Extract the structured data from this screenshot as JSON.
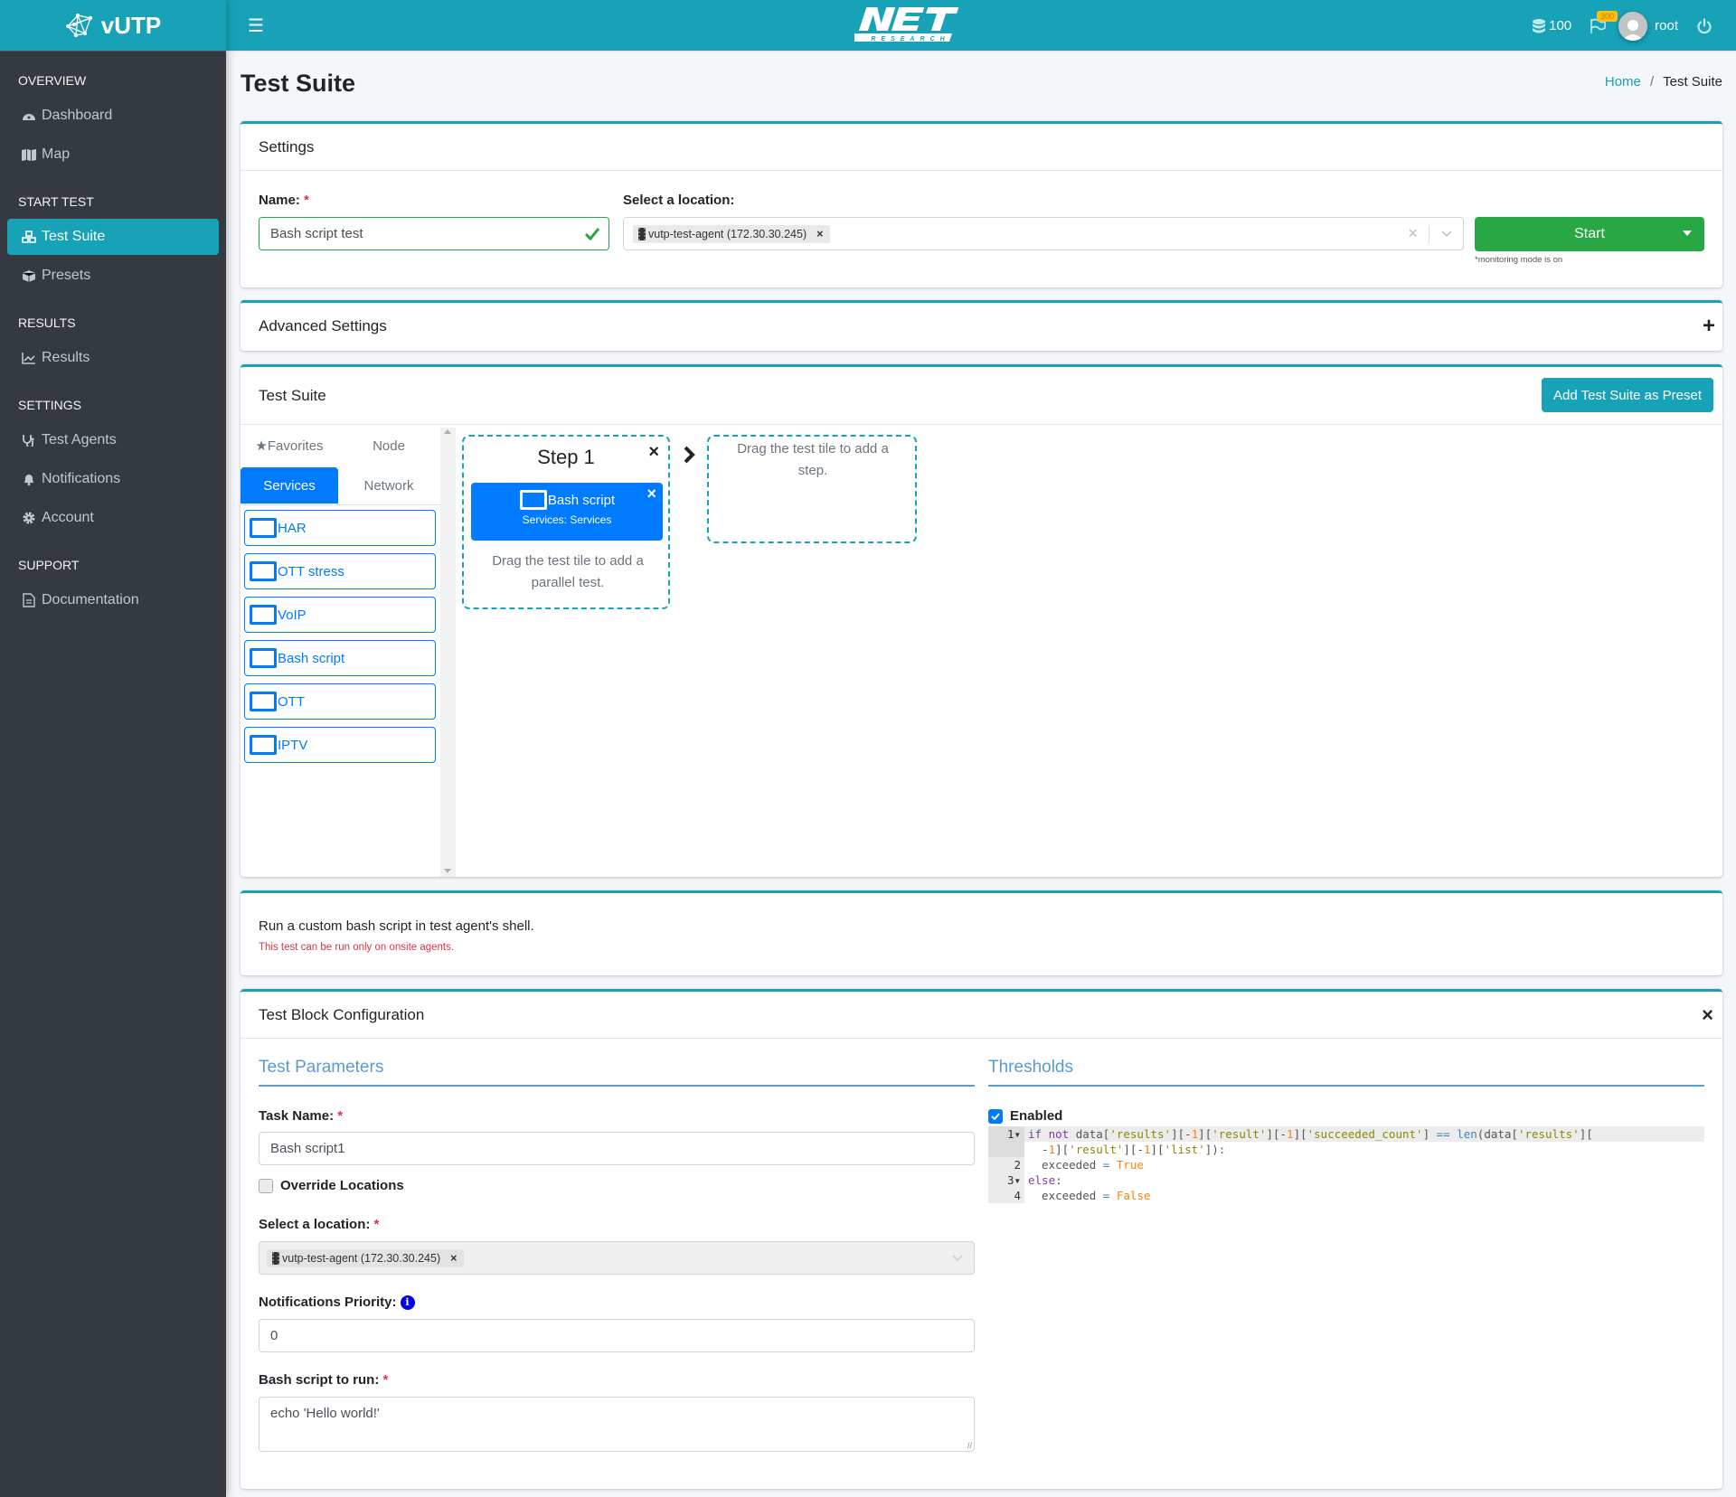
{
  "app": {
    "brand_name": "vUTP",
    "logo_text": "NET",
    "logo_subtext": "RESEARCH"
  },
  "topbar": {
    "credits": "100",
    "flag_badge": "300",
    "user": "root"
  },
  "sidebar": {
    "sections": [
      {
        "header": "OVERVIEW",
        "items": [
          {
            "label": "Dashboard",
            "icon": "dashboard-icon"
          },
          {
            "label": "Map",
            "icon": "map-icon"
          }
        ]
      },
      {
        "header": "START TEST",
        "items": [
          {
            "label": "Test Suite",
            "icon": "cubes-icon",
            "active": true
          },
          {
            "label": "Presets",
            "icon": "box-icon"
          }
        ]
      },
      {
        "header": "RESULTS",
        "items": [
          {
            "label": "Results",
            "icon": "chart-line-icon"
          }
        ]
      },
      {
        "header": "SETTINGS",
        "items": [
          {
            "label": "Test Agents",
            "icon": "stethoscope-icon"
          },
          {
            "label": "Notifications",
            "icon": "bell-icon"
          },
          {
            "label": "Account",
            "icon": "gear-icon"
          }
        ]
      },
      {
        "header": "SUPPORT",
        "items": [
          {
            "label": "Documentation",
            "icon": "file-icon"
          }
        ]
      }
    ]
  },
  "page": {
    "title": "Test Suite",
    "breadcrumb": {
      "home": "Home",
      "current": "Test Suite"
    }
  },
  "settings": {
    "title": "Settings",
    "name_label": "Name:",
    "name_value": "Bash script test",
    "location_label": "Select a location:",
    "location_chip": "vutp-test-agent (172.30.30.245)",
    "start_label": "Start",
    "monitoring_note": "*monitoring mode is on"
  },
  "advanced": {
    "title": "Advanced Settings"
  },
  "suite": {
    "title": "Test Suite",
    "add_preset_label": "Add Test Suite as Preset",
    "tabs": [
      "Favorites",
      "Node",
      "Services",
      "Network"
    ],
    "active_tab": "Services",
    "tiles": [
      "HAR",
      "OTT stress",
      "VoIP",
      "Bash script",
      "OTT",
      "IPTV"
    ],
    "step": {
      "title": "Step 1",
      "test_name": "Bash script",
      "test_category": "Services: Services",
      "parallel_hint": "Drag the test tile to add a parallel test."
    },
    "new_step_hint": "Drag the test tile to add a step."
  },
  "description": {
    "text": "Run a custom bash script in test agent's shell.",
    "warning": "This test can be run only on onsite agents."
  },
  "config": {
    "title": "Test Block Configuration",
    "params_title": "Test Parameters",
    "task_name_label": "Task Name:",
    "task_name_value": "Bash script1",
    "override_label": "Override Locations",
    "override_checked": false,
    "location_label": "Select a location:",
    "location_chip": "vutp-test-agent (172.30.30.245)",
    "priority_label": "Notifications Priority:",
    "priority_value": "0",
    "script_label": "Bash script to run:",
    "script_value": "echo 'Hello world!'",
    "thresholds_title": "Thresholds",
    "enabled_label": "Enabled",
    "enabled_checked": true,
    "code_lines": [
      {
        "n": "1",
        "fold": true,
        "text": "if not data['results'][-1]['result'][-1]['succeeded_count'] == len(data['results'][",
        "cont": "  -1]['result'][-1]['list']):"
      },
      {
        "n": "2",
        "fold": false,
        "text": "  exceeded = True"
      },
      {
        "n": "3",
        "fold": true,
        "text": "else:"
      },
      {
        "n": "4",
        "fold": false,
        "text": "  exceeded = False"
      }
    ]
  },
  "colors": {
    "accent": "#17a2b8",
    "primary": "#007bff",
    "success": "#28a745",
    "sidebar": "#343a40",
    "danger": "#dc3545"
  }
}
